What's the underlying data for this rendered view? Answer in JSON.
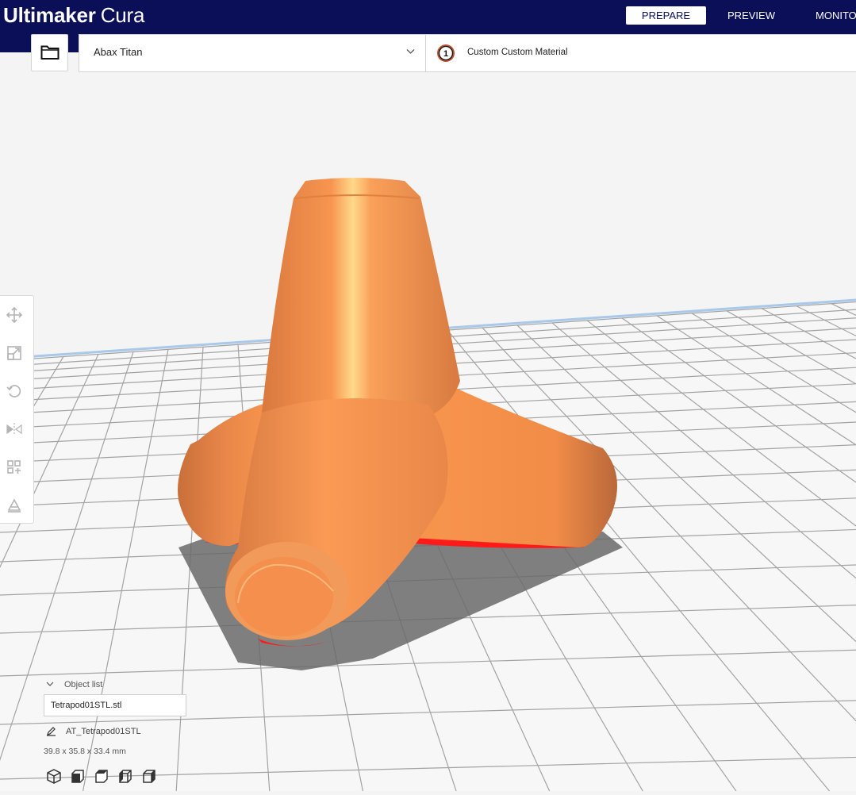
{
  "app": {
    "logo_brand": "Ultimaker",
    "logo_product": "Cura"
  },
  "stages": {
    "prepare": "PREPARE",
    "preview": "PREVIEW",
    "monitor": "MONITOR",
    "active": "prepare"
  },
  "printer": {
    "name": "Abax Titan"
  },
  "extruder": {
    "number": "1",
    "material": "Custom Custom Material"
  },
  "toolbar": {
    "tools": [
      "move-icon",
      "scale-icon",
      "rotate-icon",
      "mirror-icon",
      "per-model-settings-icon",
      "support-blocker-icon"
    ]
  },
  "object_list": {
    "title": "Object list",
    "items": [
      "Tetrapod01STL.stl"
    ],
    "selected_name": "AT_Tetrapod01STL",
    "dimensions": "39.8 x 35.8 x 33.4 mm"
  },
  "view_buttons": [
    "view-3d-icon",
    "view-front-icon",
    "view-top-icon",
    "view-left-icon",
    "view-right-icon"
  ],
  "colors": {
    "header": "#0a0f57",
    "model": "#f7954d",
    "overhang": "#ff1a1a",
    "build_plate": "#f6f6f6",
    "grid": "#9a9a9a"
  }
}
